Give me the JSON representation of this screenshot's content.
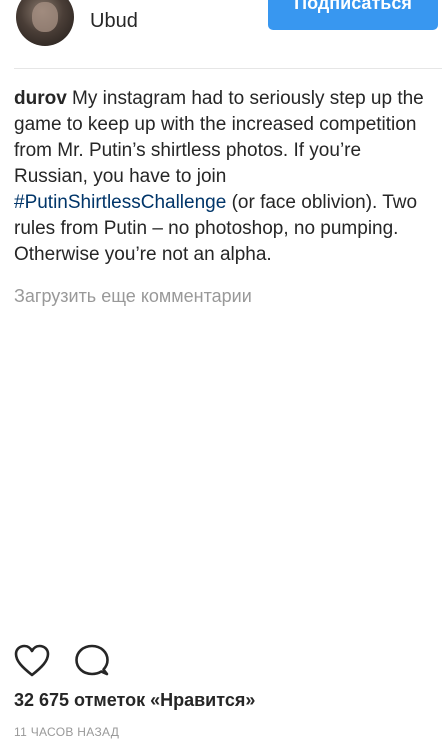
{
  "header": {
    "location": "Ubud",
    "follow_label": "Подписаться"
  },
  "caption": {
    "username": "durov",
    "text_before": " My instagram had to seriously step up the game to keep up with the increased competition from Mr. Putin’s shirtless photos. If you’re Russian, you have to join ",
    "hashtag": "#PutinShirtlessChallenge",
    "text_after": " (or face oblivion). Two rules from Putin – no photoshop, no pumping. Otherwise you’re not an alpha."
  },
  "comments": {
    "load_more_label": "Загрузить еще комментарии"
  },
  "actions": {
    "like_icon": "heart-outline-icon",
    "comment_icon": "speech-bubble-icon"
  },
  "likes": {
    "label": "32 675 отметок «Нравится»"
  },
  "timestamp": "11 ЧАСОВ НАЗАД",
  "colors": {
    "follow_button": "#3897f0",
    "hashtag": "#003569",
    "secondary_text": "#999999",
    "primary_text": "#262626"
  }
}
